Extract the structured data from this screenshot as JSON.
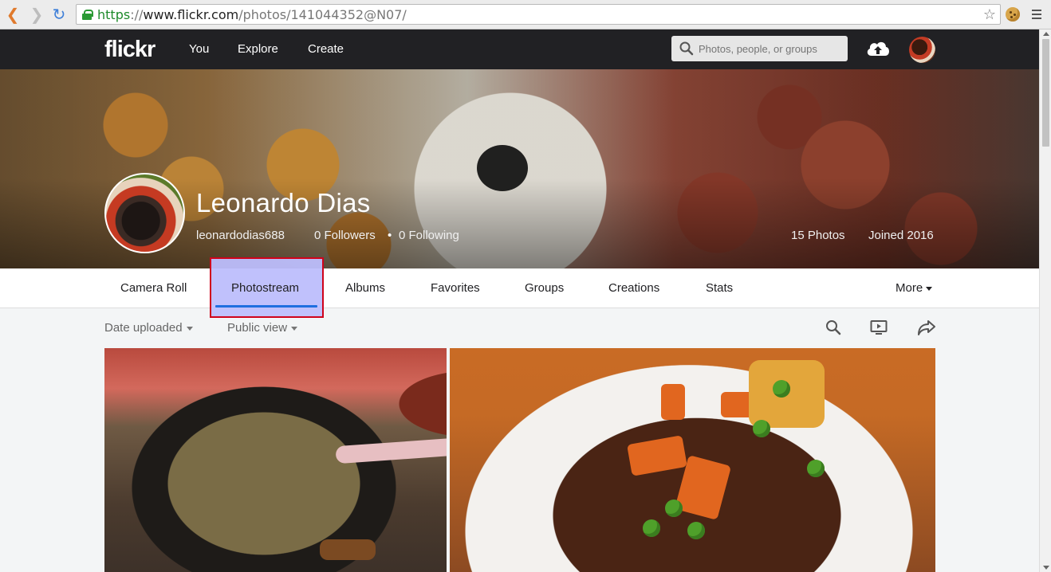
{
  "browser": {
    "url_scheme": "https",
    "url_sep": "://",
    "url_domain": "www.flickr.com",
    "url_path": "/photos/141044352@N07/",
    "back_icon": "chevron-left-icon",
    "forward_icon": "chevron-right-icon",
    "reload_icon": "reload-icon",
    "star_icon": "star-icon"
  },
  "nav": {
    "logo": "flickr",
    "links": [
      "You",
      "Explore",
      "Create"
    ],
    "search_placeholder": "Photos, people, or groups"
  },
  "profile": {
    "name": "Leonardo Dias",
    "username": "leonardodias688",
    "followers": "0 Followers",
    "separator": "•",
    "following": "0 Following",
    "photos": "15 Photos",
    "joined": "Joined 2016"
  },
  "tabs": {
    "camera_roll": "Camera Roll",
    "photostream": "Photostream",
    "albums": "Albums",
    "favorites": "Favorites",
    "groups": "Groups",
    "creations": "Creations",
    "stats": "Stats",
    "more": "More"
  },
  "filters": {
    "sort": "Date uploaded",
    "view": "Public view"
  },
  "colors": {
    "accent": "#1f6fe0",
    "highlight_border": "#d0021b",
    "highlight_fill": "#bdbefc",
    "nav_bg": "#212124"
  }
}
